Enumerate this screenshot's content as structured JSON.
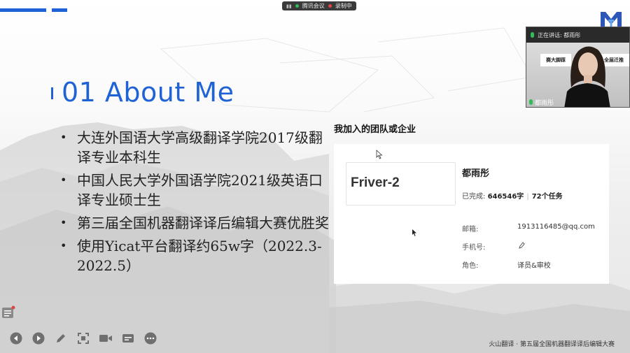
{
  "meeting_bar": {
    "app_label": "腾讯会议",
    "record_label": "录制中"
  },
  "slide": {
    "title": "01 About Me",
    "bullets": [
      "大连外国语大学高级翻译学院2017级翻译专业本科生",
      "中国人民大学外国语学院2021级英语口译专业硕士生",
      "第三届全国机器翻译译后编辑大赛优胜奖",
      "使用Yicat平台翻译约65w字（2022.3-2022.5）"
    ],
    "footer": "火山翻译 · 第五届全国机器翻译译后编辑大赛"
  },
  "video": {
    "speaking_label": "正在讲话: 都雨彤",
    "participant_name": "都雨彤",
    "sign_left": "赛大脚踩",
    "sign_right": "全届迁推"
  },
  "team_panel": {
    "heading": "我加入的团队或企业",
    "team_name": "Friver-2",
    "user_name": "都雨彤",
    "done_label": "已完成:",
    "done_value": "646546字",
    "tasks_value": "72个任务",
    "email_label": "邮箱:",
    "email_value": "1913116485@qq.com",
    "phone_label": "手机号:",
    "role_label": "角色:",
    "role_value": "译员&审校"
  },
  "toolbar_icons": [
    "prev-icon",
    "next-icon",
    "pen-icon",
    "screenshot-icon",
    "camera-icon",
    "caption-icon",
    "more-icon"
  ],
  "colors": {
    "accent": "#1e62d6",
    "toolbar_icon": "#6f6f6f",
    "mic_green": "#2fbd5a",
    "record_red": "#e04545"
  }
}
